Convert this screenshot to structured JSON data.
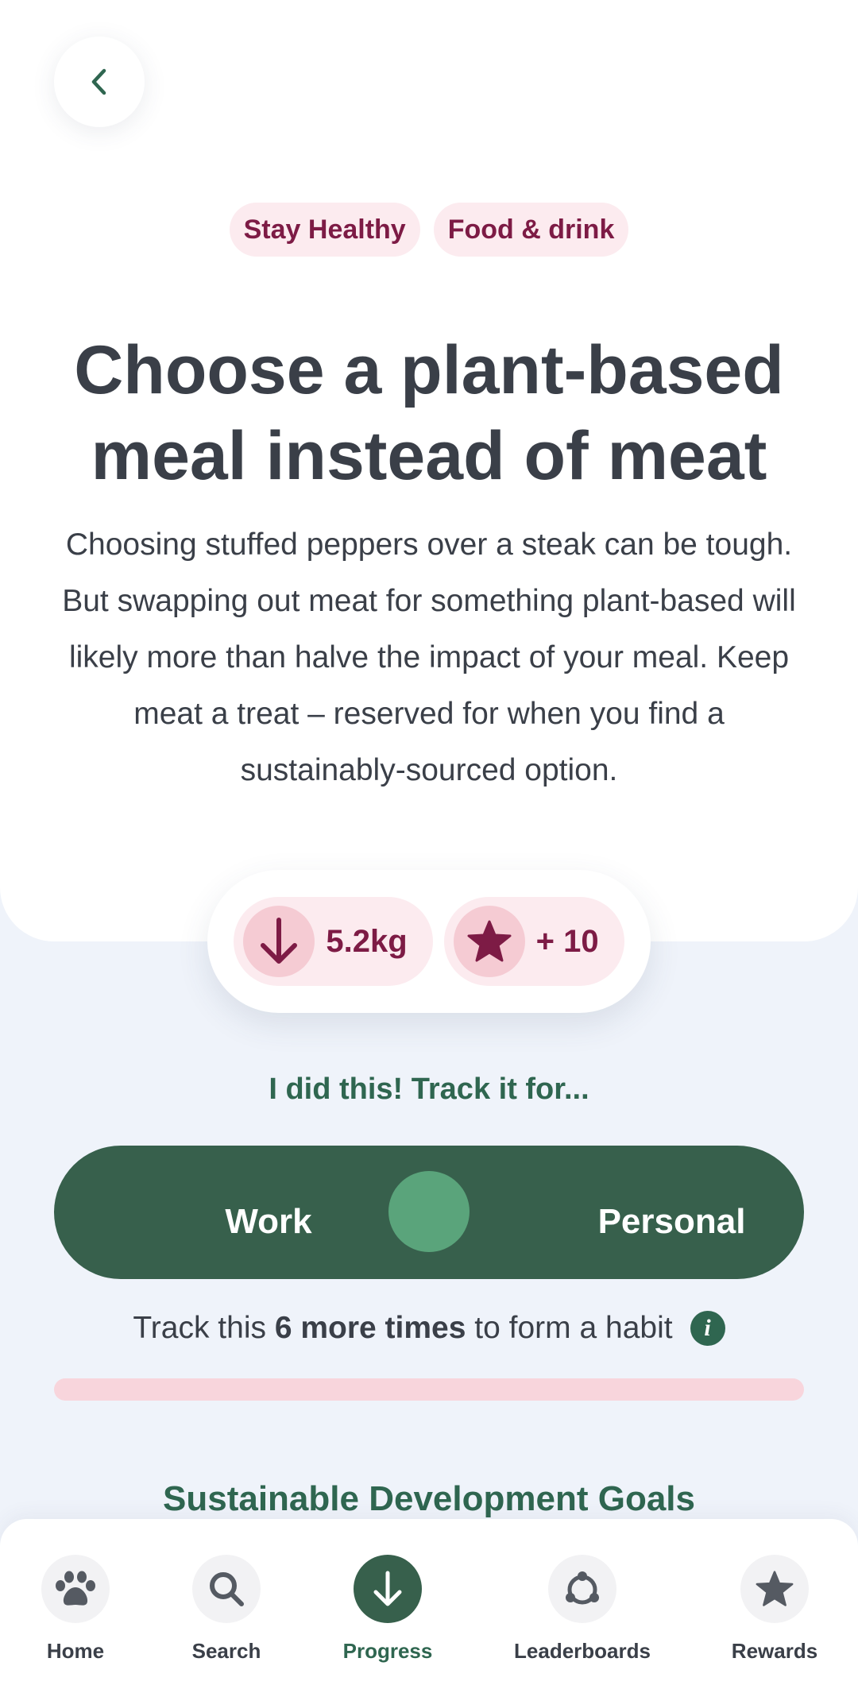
{
  "tags": [
    "Stay Healthy",
    "Food & drink"
  ],
  "title": "Choose a plant-based meal instead of meat",
  "description": "Choosing stuffed peppers over a steak can be tough. But swapping out meat for something plant-based will likely more than halve the impact of your meal. Keep meat a treat – reserved for when you find a sustainably-sourced option.",
  "stats": {
    "carbon": "5.2kg",
    "points": "+ 10"
  },
  "track": {
    "heading": "I did this! Track it for...",
    "options": [
      "Work",
      "Personal"
    ]
  },
  "habit": {
    "prefix": "Track this",
    "bold": "6 more times",
    "suffix": "to form a habit",
    "progress": 0
  },
  "sdg_heading": "Sustainable Development Goals",
  "nav": {
    "items": [
      {
        "label": "Home",
        "icon": "paw-icon"
      },
      {
        "label": "Search",
        "icon": "search-icon"
      },
      {
        "label": "Progress",
        "icon": "arrow-down-icon",
        "active": true
      },
      {
        "label": "Leaderboards",
        "icon": "leaderboard-icon"
      },
      {
        "label": "Rewards",
        "icon": "star-icon"
      }
    ]
  },
  "colors": {
    "primary_green": "#37604c",
    "accent_green": "#5aa47b",
    "tag_text": "#7d1b45",
    "tag_bg": "#fcebef",
    "progress_track": "#f8d5dc",
    "page_bg": "#eff3fa"
  }
}
